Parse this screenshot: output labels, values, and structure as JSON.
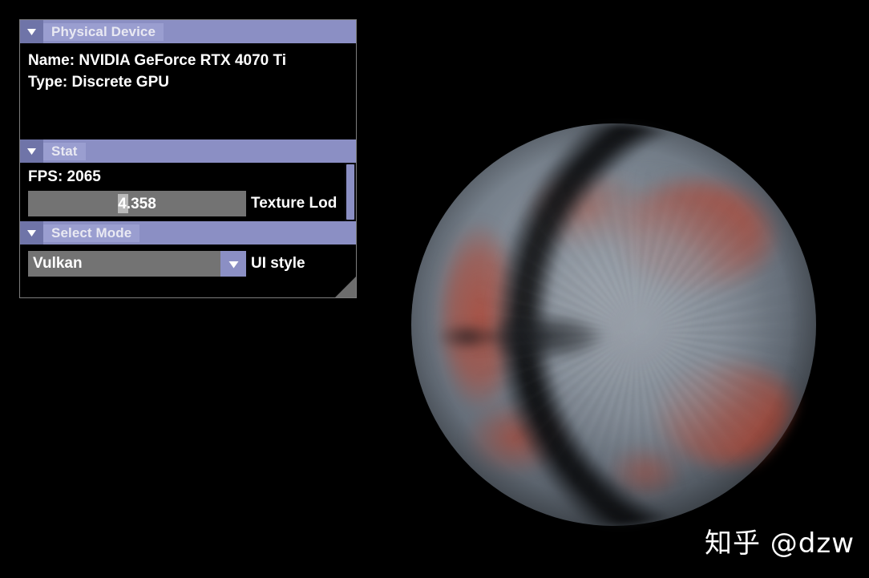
{
  "app": {
    "renderer_background": "#000000",
    "accent_header": "#8b8fc4",
    "accent_title_bg": "#9a9ed0",
    "widget_bg": "#737373"
  },
  "panel": {
    "sections": [
      {
        "id": "physical-device",
        "title": "Physical Device",
        "collapse_icon": "chevron-down-icon",
        "lines": [
          "Name: NVIDIA GeForce RTX 4070 Ti",
          "Type: Discrete GPU"
        ]
      },
      {
        "id": "stat",
        "title": "Stat",
        "collapse_icon": "chevron-down-icon",
        "fps_line": "FPS: 2065",
        "slider": {
          "value_text": "4.358",
          "value": 4.358,
          "label": "Texture Lod"
        },
        "has_scrollbar": true
      },
      {
        "id": "select-mode",
        "title": "Select Mode",
        "collapse_icon": "chevron-down-icon",
        "combo": {
          "selected": "Vulkan",
          "label": "UI style",
          "arrow_icon": "triangle-down-icon"
        }
      }
    ],
    "resize_grip_icon": "resize-grip-icon"
  },
  "scene": {
    "object_name": "textured-sphere",
    "description": "Shaded sphere with red-brown and grey-blue texture regions"
  },
  "watermark": {
    "text": "知乎 @dzw"
  }
}
